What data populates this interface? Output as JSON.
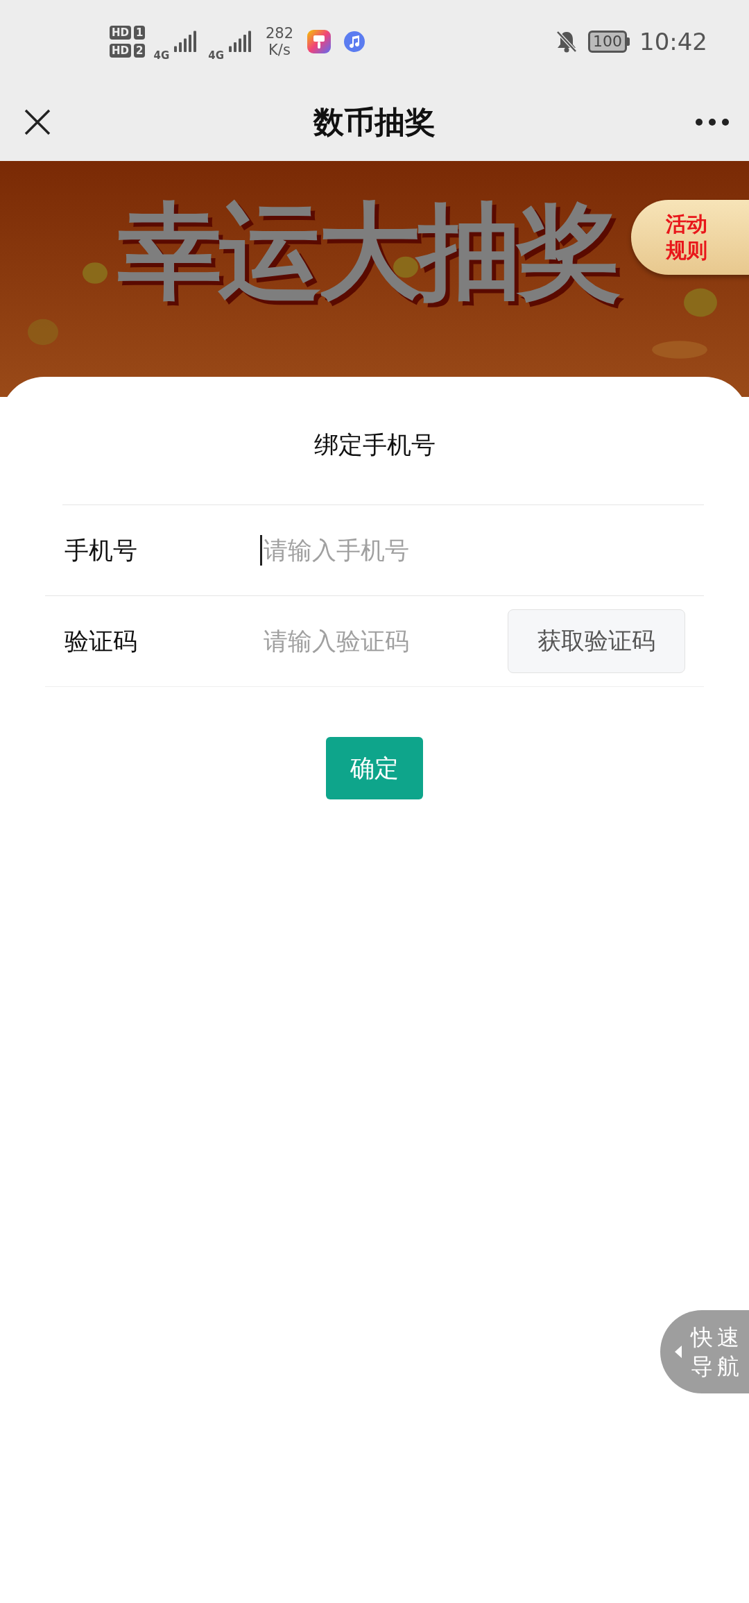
{
  "status_bar": {
    "sims": [
      {
        "badge": "HD",
        "slot": "1",
        "network": "4G"
      },
      {
        "badge": "HD",
        "slot": "2",
        "network": "4G"
      }
    ],
    "speed_value": "282",
    "speed_unit": "K/s",
    "battery": "100",
    "time": "10:42"
  },
  "nav_bar": {
    "title": "数币抽奖"
  },
  "banner": {
    "headline": "幸运大抽奖",
    "rules_line_1": "活动",
    "rules_line_2": "规则"
  },
  "sheet": {
    "title": "绑定手机号",
    "fields": [
      {
        "kind": "input",
        "label": "手机号",
        "placeholder": "请输入手机号",
        "focused": true
      },
      {
        "kind": "code",
        "label": "验证码",
        "placeholder": "请输入验证码",
        "focused": false,
        "button": "获取验证码"
      }
    ],
    "confirm": "确定"
  },
  "quick_nav": {
    "label_line_1": "快速",
    "label_line_2": "导航"
  }
}
